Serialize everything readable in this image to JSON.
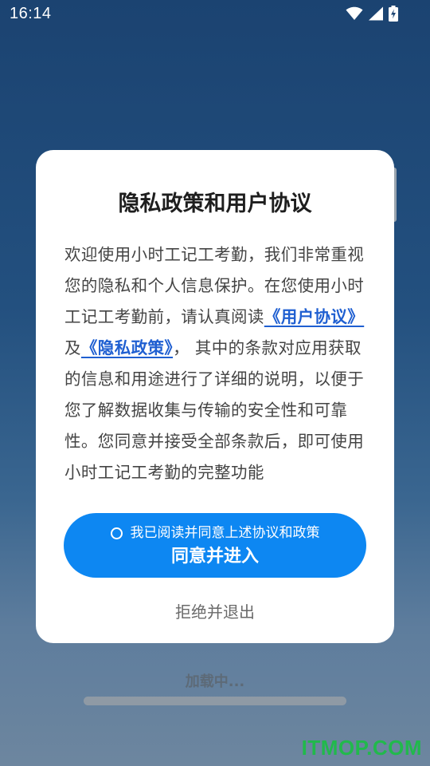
{
  "status_bar": {
    "time": "16:14",
    "icons": [
      "wifi-icon",
      "cellular-signal-icon",
      "battery-charging-icon"
    ]
  },
  "dialog": {
    "title": "隐私政策和用户协议",
    "body": {
      "intro": "欢迎使用小时工记工考勤，我们非常重视您的隐私和个人信息保护。在您使用小时工记工考勤前，请认真阅读",
      "user_agreement_link": "《用户协议》",
      "and": "及",
      "privacy_policy_link": "《隐私政策》",
      "rest": "， 其中的条款对应用获取的信息和用途进行了详细的说明，以便于您了解数据收集与传输的安全性和可靠性。您同意并接受全部条款后，即可使用小时工记工考勤的完整功能"
    },
    "agree_checkbox_label": "我已阅读并同意上述协议和政策",
    "agree_button_label": "同意并进入",
    "reject_button_label": "拒绝并退出"
  },
  "loading": {
    "text": "加载中...",
    "progress": 1.0
  },
  "watermark": "ITMOP.COM",
  "colors": {
    "accent": "#0d87f2",
    "link": "#1f5fd1",
    "watermark": "#21b94c"
  }
}
